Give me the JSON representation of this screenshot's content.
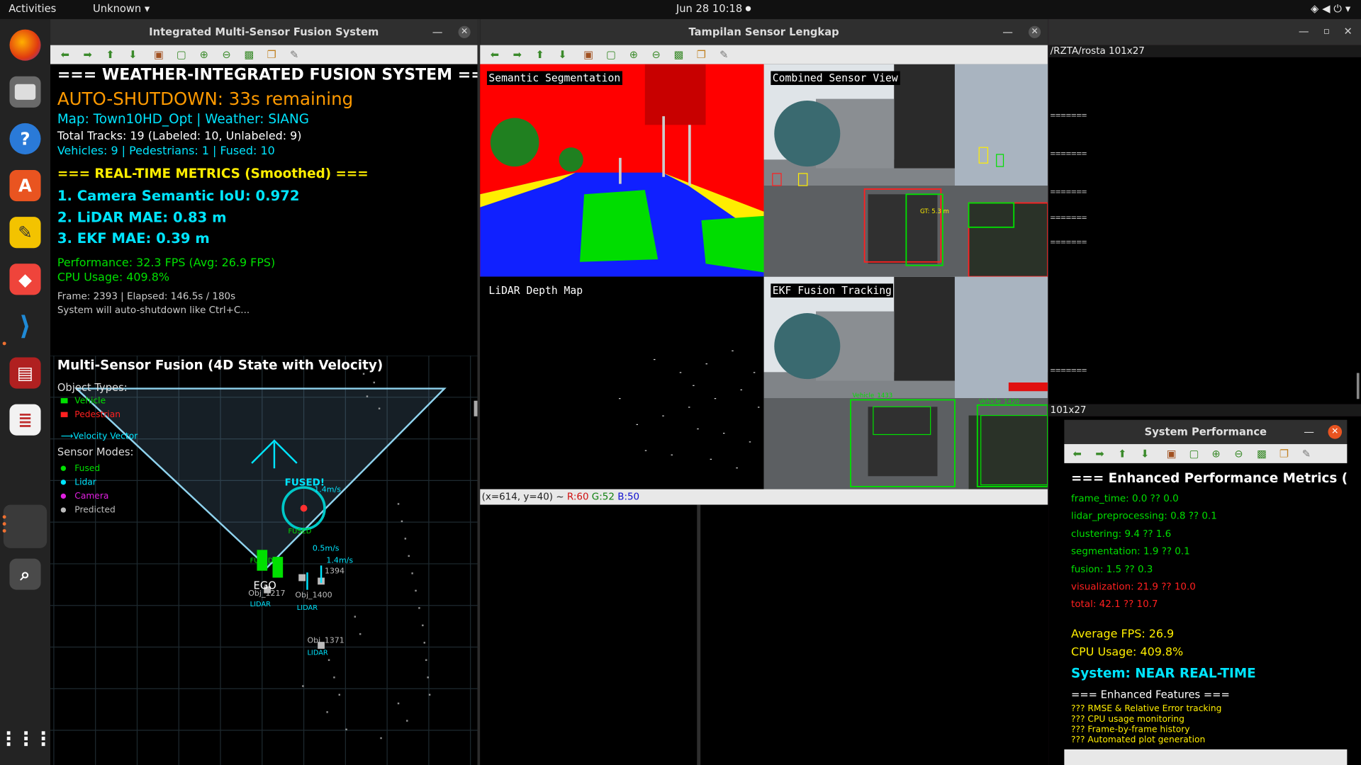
{
  "topbar": {
    "activities": "Activities",
    "app_menu": "Unknown",
    "clock": "Jun 28  10:18"
  },
  "dock_icons": [
    "firefox-icon",
    "files-icon",
    "help-icon",
    "software-icon",
    "text-editor-icon",
    "anydesk-icon",
    "vscode-icon",
    "monitor-icon",
    "document-viewer-icon",
    "active-app-icon",
    "search-app-icon",
    "show-apps-icon"
  ],
  "fusion_window": {
    "title": "Integrated Multi-Sensor Fusion System",
    "header": "=== WEATHER-INTEGRATED FUSION SYSTEM ===",
    "shutdown": "AUTO-SHUTDOWN: 33s remaining",
    "map": "Map: Town10HD_Opt | Weather: SIANG",
    "tracks": "Total Tracks: 19 (Labeled: 10, Unlabeled: 9)",
    "counts": "Vehicles: 9 | Pedestrians: 1 | Fused: 10",
    "metrics_header": "=== REAL-TIME METRICS (Smoothed) ===",
    "metric_1": "1. Camera Semantic IoU: 0.972",
    "metric_2": "2. LiDAR MAE: 0.83 m",
    "metric_3": "3. EKF MAE: 0.39 m",
    "performance": "Performance: 32.3 FPS (Avg: 26.9 FPS)",
    "cpu": "CPU Usage: 409.8%",
    "frame": "Frame: 2393 | Elapsed: 146.5s / 180s",
    "note": "System will auto-shutdown like Ctrl+C...",
    "bev_title": "Multi-Sensor Fusion (4D State with Velocity)",
    "object_types_label": "Object Types:",
    "legend_vehicle": "Vehicle",
    "legend_pedestrian": "Pedestrian",
    "legend_velocity": "Velocity Vector",
    "sensor_modes_label": "Sensor Modes:",
    "mode_fused": "Fused",
    "mode_lidar": "Lidar",
    "mode_camera": "Camera",
    "mode_predicted": "Predicted",
    "fused_label": "FUSED!",
    "ego_label": "EGO",
    "speed_1": "1.4m/s",
    "speed_2": "0.5m/s",
    "speed_3": "1.4m/s",
    "obj_1394": "1394",
    "obj_1371": "Obj_1371",
    "obj_1400": "Obj_1400",
    "obj_1217": "Obj_1217",
    "lidar_tag": "LIDAR",
    "fused_tag": "FUSED"
  },
  "sensor_window": {
    "title": "Tampilan Sensor Lengkap",
    "label_segmentation": "Semantic Segmentation",
    "label_combined": "Combined Sensor View",
    "label_lidar": "LiDAR Depth Map",
    "label_ekf": "EKF Fusion Tracking",
    "status_xy": "(x=614, y=40) ~ ",
    "status_r": "R:60",
    "status_g": "G:52",
    "status_b": "B:50",
    "cam_vehicle_label": "Vehicle_1433",
    "cam_vehicle_label_2": "Vehicle_1420",
    "cam_gt": "GT: 5.3 m"
  },
  "terminal": {
    "title_right": "/RZTA/rosta 101x27",
    "title_lower": "101x27",
    "separator": "======="
  },
  "perf_window": {
    "title": "System Performance",
    "heading": "=== Enhanced Performance Metrics (m",
    "frame_time": "frame_time: 0.0 ?? 0.0",
    "lidar_pre": "lidar_preprocessing: 0.8 ?? 0.1",
    "clustering": "clustering: 9.4 ?? 1.6",
    "segmentation": "segmentation: 1.9 ?? 0.1",
    "fusion": "fusion: 1.5 ?? 0.3",
    "visualization": "visualization: 21.9 ?? 10.0",
    "total": "total: 42.1 ?? 10.7",
    "avg_fps": "Average FPS: 26.9",
    "cpu": "CPU Usage: 409.8%",
    "system": "System: NEAR REAL-TIME",
    "features_header": "=== Enhanced Features ===",
    "feature_1": "??? RMSE & Relative Error tracking",
    "feature_2": "??? CPU usage monitoring",
    "feature_3": "??? Frame-by-frame history",
    "feature_4": "??? Automated plot generation"
  },
  "colors": {
    "cyan": "#00e5ff",
    "yellow": "#ffee00",
    "orange": "#ff9a00",
    "green": "#00e000",
    "red": "#ff2020"
  }
}
